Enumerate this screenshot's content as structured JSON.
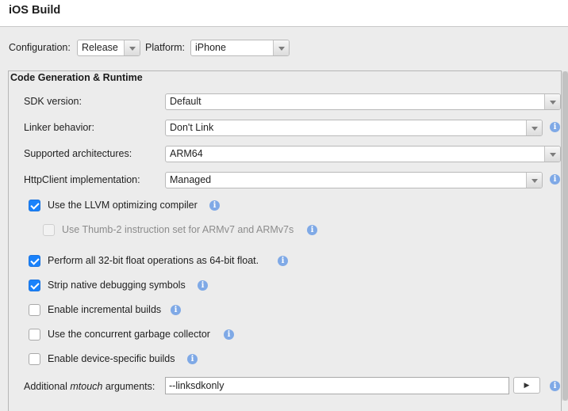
{
  "header": {
    "title": "iOS Build"
  },
  "toolbar": {
    "configuration_label": "Configuration:",
    "configuration_value": "Release",
    "platform_label": "Platform:",
    "platform_value": "iPhone"
  },
  "section": {
    "title": "Code Generation & Runtime",
    "fields": [
      {
        "label": "SDK version:",
        "value": "Default"
      },
      {
        "label": "Linker behavior:",
        "value": "Don't Link"
      },
      {
        "label": "Supported architectures:",
        "value": "ARM64"
      },
      {
        "label": "HttpClient implementation:",
        "value": "Managed"
      }
    ],
    "checkboxes": [
      {
        "label": "Use the LLVM optimizing compiler",
        "checked": true,
        "enabled": true
      },
      {
        "label": "Use Thumb-2 instruction set for ARMv7 and ARMv7s",
        "checked": false,
        "enabled": false
      },
      {
        "label": "Perform all 32-bit float operations as 64-bit float.",
        "checked": true,
        "enabled": true
      },
      {
        "label": "Strip native debugging symbols",
        "checked": true,
        "enabled": true
      },
      {
        "label": "Enable incremental builds",
        "checked": false,
        "enabled": true
      },
      {
        "label": "Use the concurrent garbage collector",
        "checked": false,
        "enabled": true
      },
      {
        "label": "Enable device-specific builds",
        "checked": false,
        "enabled": true
      }
    ],
    "mtouch": {
      "label_prefix": "Additional ",
      "label_emphasis": "mtouch",
      "label_suffix": " arguments:",
      "value": "--linksdkonly",
      "run_glyph": "▶"
    },
    "info_glyph": "i"
  },
  "colors": {
    "accent": "#1a82fb",
    "info": "#7fa9e6"
  },
  "icons": {
    "info": "info-icon",
    "dropdown": "chevron-down-icon",
    "run": "play-icon"
  }
}
